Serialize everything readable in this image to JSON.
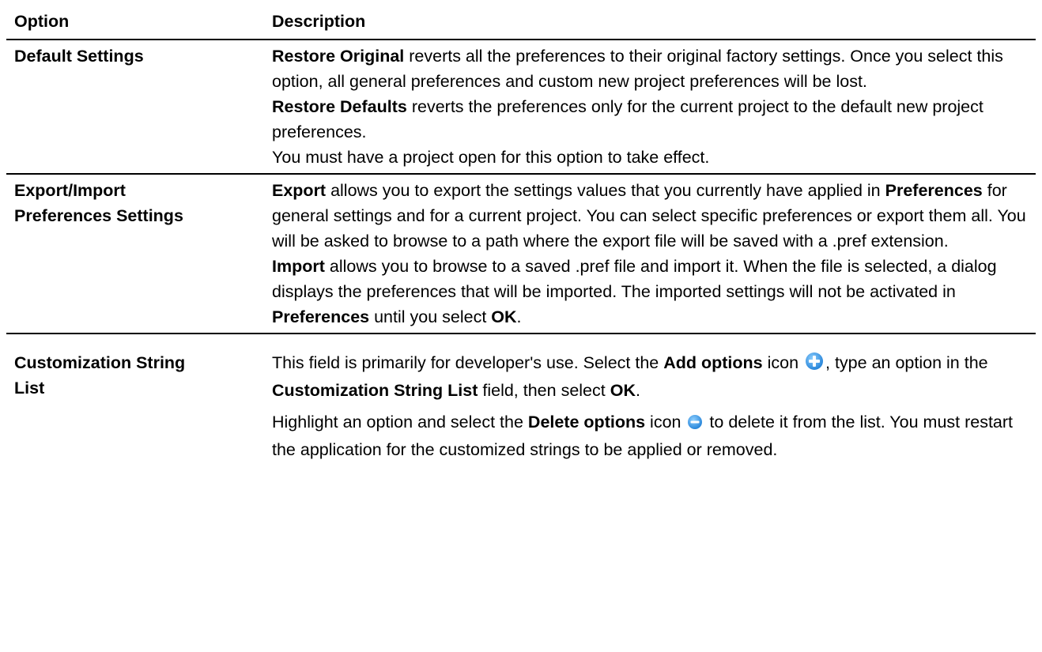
{
  "headers": {
    "option": "Option",
    "description": "Description"
  },
  "rows": [
    {
      "option_lines": [
        "Default Settings"
      ],
      "restore_original": {
        "term": "Restore Original",
        "text": " reverts all the preferences to their original factory settings. Once you select this option, all general preferences and custom new project preferences will be lost."
      },
      "restore_defaults": {
        "term": "Restore Defaults",
        "text": " reverts the preferences only for the current project to the default new project preferences."
      },
      "note": "You must have a project open for this option to take effect."
    },
    {
      "option_lines": [
        "Export/Import",
        "Preferences Settings"
      ],
      "export": {
        "term": "Export",
        "text1": " allows you to export the settings values that you currently have applied in ",
        "term2": "Preferences",
        "text2": " for general settings and for a current project. You can select specific preferences or export them all. You will be asked to browse to a path where the export file will be saved with a .pref extension."
      },
      "import": {
        "term": "Import",
        "text1": " allows you to browse to a saved .pref file and import it. When the file is selected, a dialog displays the preferences that will be imported. The imported settings will not be activated in ",
        "term2": "Preferences",
        "text2": " until you select ",
        "term3": "OK",
        "text3": "."
      }
    },
    {
      "option_lines": [
        "Customization String",
        "List"
      ],
      "add": {
        "text1": "This field is primarily for developer's use. Select the ",
        "term1": "Add options",
        "text2": " icon ",
        "text3": ", type an option in the ",
        "term2": "Customization String List",
        "text4": " field, then select ",
        "term3": "OK",
        "text5": "."
      },
      "delete": {
        "text1": "Highlight an option and select the ",
        "term1": "Delete options",
        "text2": " icon ",
        "text3": " to delete it from the list. You must restart the application for the customized strings to be applied or removed."
      }
    }
  ],
  "icons": {
    "add": "add-circle-icon",
    "delete": "remove-circle-icon"
  },
  "colors": {
    "icon_blue": "#2f8fe0"
  }
}
